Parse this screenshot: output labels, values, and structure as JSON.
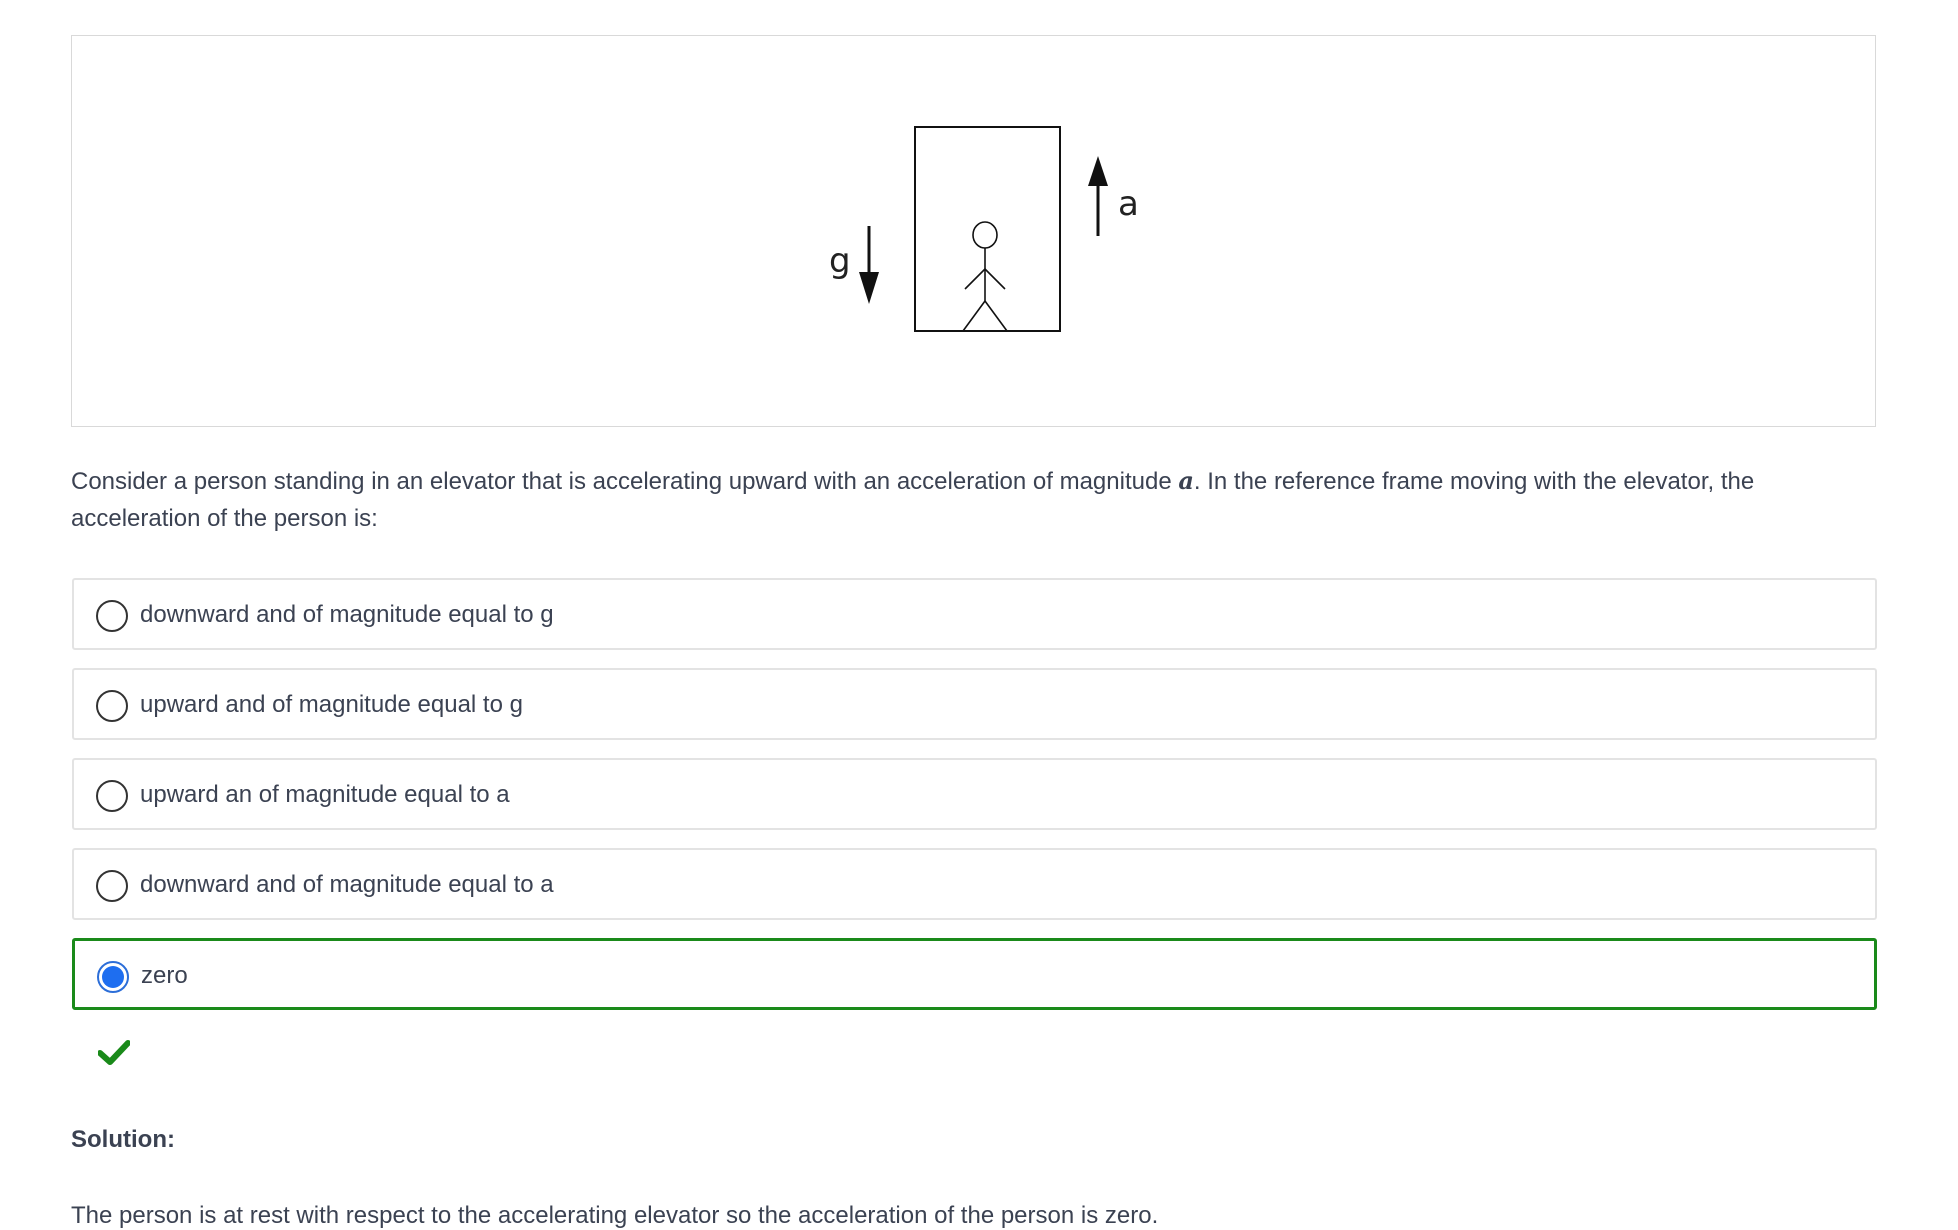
{
  "figure": {
    "label_g": "g",
    "label_a": "a"
  },
  "question": {
    "text_before": "Consider a person standing in an elevator that is accelerating upward with an acceleration of magnitude ",
    "math_symbol": "a",
    "text_after": ". In the reference frame moving with the elevator, the acceleration of the person is:"
  },
  "choices": [
    {
      "label": "downward and of magnitude equal to g",
      "selected": false
    },
    {
      "label": "upward and of magnitude equal to g",
      "selected": false
    },
    {
      "label": "upward an of magnitude equal to a",
      "selected": false
    },
    {
      "label": "downward and of magnitude equal to a",
      "selected": false
    },
    {
      "label": "zero",
      "selected": true
    }
  ],
  "feedback": {
    "icon": "checkmark-icon",
    "color": "#1a8a1a"
  },
  "solution": {
    "heading": "Solution:",
    "text": "The person is at rest with respect to the accelerating elevator so the acceleration of the person is zero."
  }
}
